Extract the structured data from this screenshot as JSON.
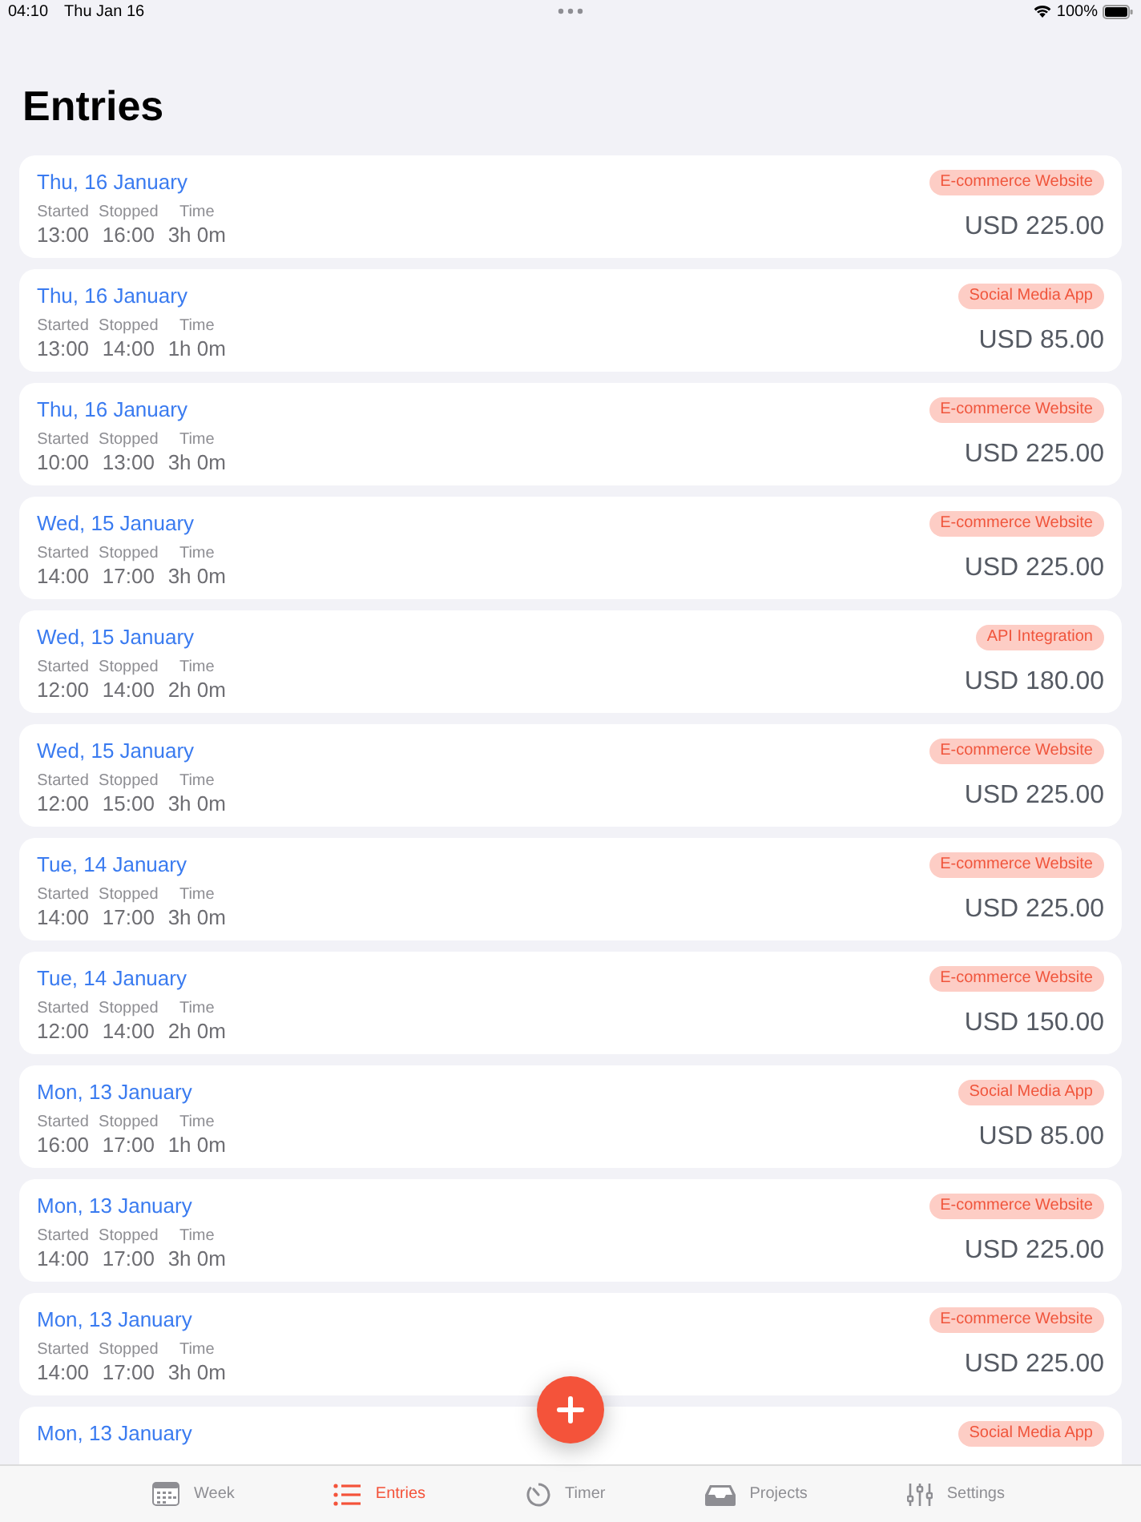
{
  "status_bar": {
    "time": "04:10",
    "date": "Thu Jan 16",
    "battery": "100%"
  },
  "title": "Entries",
  "entries": [
    {
      "date": "Thu, 16 January",
      "project": "E-commerce Website",
      "started_label": "Started",
      "started": "13:00",
      "stopped_label": "Stopped",
      "stopped": "16:00",
      "time_label": "Time",
      "time": "3h 0m",
      "amount": "USD 225.00"
    },
    {
      "date": "Thu, 16 January",
      "project": "Social Media App",
      "started_label": "Started",
      "started": "13:00",
      "stopped_label": "Stopped",
      "stopped": "14:00",
      "time_label": "Time",
      "time": "1h 0m",
      "amount": "USD 85.00"
    },
    {
      "date": "Thu, 16 January",
      "project": "E-commerce Website",
      "started_label": "Started",
      "started": "10:00",
      "stopped_label": "Stopped",
      "stopped": "13:00",
      "time_label": "Time",
      "time": "3h 0m",
      "amount": "USD 225.00"
    },
    {
      "date": "Wed, 15 January",
      "project": "E-commerce Website",
      "started_label": "Started",
      "started": "14:00",
      "stopped_label": "Stopped",
      "stopped": "17:00",
      "time_label": "Time",
      "time": "3h 0m",
      "amount": "USD 225.00"
    },
    {
      "date": "Wed, 15 January",
      "project": "API Integration",
      "started_label": "Started",
      "started": "12:00",
      "stopped_label": "Stopped",
      "stopped": "14:00",
      "time_label": "Time",
      "time": "2h 0m",
      "amount": "USD 180.00"
    },
    {
      "date": "Wed, 15 January",
      "project": "E-commerce Website",
      "started_label": "Started",
      "started": "12:00",
      "stopped_label": "Stopped",
      "stopped": "15:00",
      "time_label": "Time",
      "time": "3h 0m",
      "amount": "USD 225.00"
    },
    {
      "date": "Tue, 14 January",
      "project": "E-commerce Website",
      "started_label": "Started",
      "started": "14:00",
      "stopped_label": "Stopped",
      "stopped": "17:00",
      "time_label": "Time",
      "time": "3h 0m",
      "amount": "USD 225.00"
    },
    {
      "date": "Tue, 14 January",
      "project": "E-commerce Website",
      "started_label": "Started",
      "started": "12:00",
      "stopped_label": "Stopped",
      "stopped": "14:00",
      "time_label": "Time",
      "time": "2h 0m",
      "amount": "USD 150.00"
    },
    {
      "date": "Mon, 13 January",
      "project": "Social Media App",
      "started_label": "Started",
      "started": "16:00",
      "stopped_label": "Stopped",
      "stopped": "17:00",
      "time_label": "Time",
      "time": "1h 0m",
      "amount": "USD 85.00"
    },
    {
      "date": "Mon, 13 January",
      "project": "E-commerce Website",
      "started_label": "Started",
      "started": "14:00",
      "stopped_label": "Stopped",
      "stopped": "17:00",
      "time_label": "Time",
      "time": "3h 0m",
      "amount": "USD 225.00"
    },
    {
      "date": "Mon, 13 January",
      "project": "E-commerce Website",
      "started_label": "Started",
      "started": "14:00",
      "stopped_label": "Stopped",
      "stopped": "17:00",
      "time_label": "Time",
      "time": "3h 0m",
      "amount": "USD 225.00"
    },
    {
      "date": "Mon, 13 January",
      "project": "Social Media App"
    }
  ],
  "tabs": [
    {
      "kind": "week",
      "label": "Week",
      "selected": false
    },
    {
      "kind": "entries",
      "label": "Entries",
      "selected": true
    },
    {
      "kind": "timer",
      "label": "Timer",
      "selected": false
    },
    {
      "kind": "projects",
      "label": "Projects",
      "selected": false
    },
    {
      "kind": "settings",
      "label": "Settings",
      "selected": false
    }
  ]
}
